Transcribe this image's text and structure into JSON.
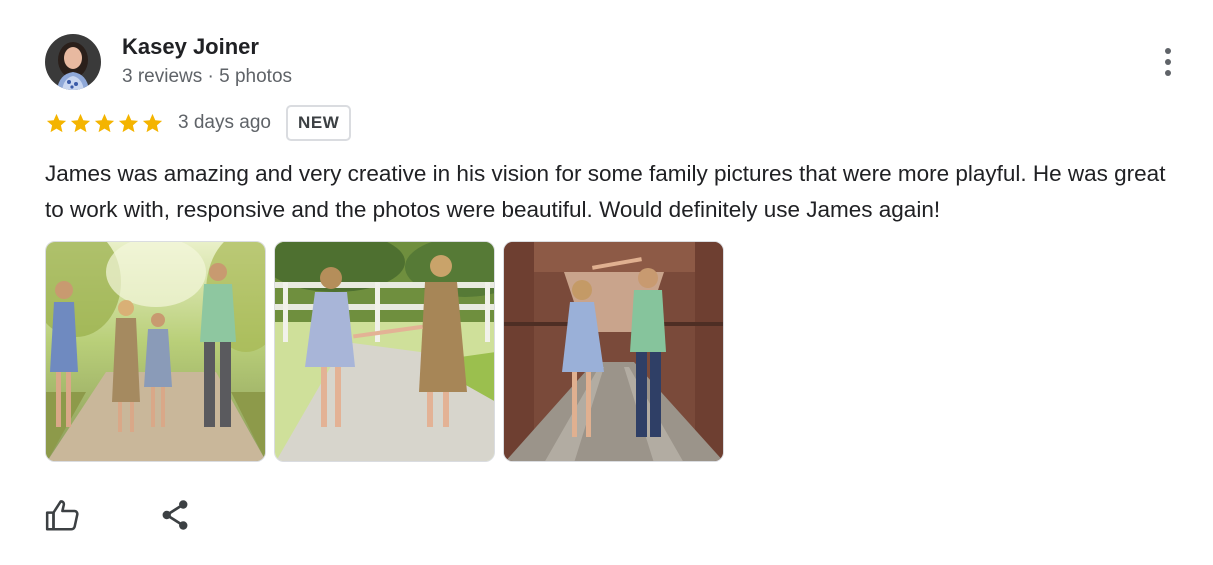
{
  "author": {
    "name": "Kasey Joiner",
    "meta": "3 reviews · 5 photos"
  },
  "review": {
    "rating": 5,
    "rating_max": 5,
    "date": "3 days ago",
    "badge": "NEW",
    "text": "James was amazing and very creative in his vision for some family pictures that were more playful. He was great to work with, responsive and the photos were beautiful. Would definitely use James again!",
    "photo_count": 3
  },
  "colors": {
    "star": "#f4b400",
    "text_primary": "#202124",
    "text_secondary": "#5f6368",
    "border": "#dadce0"
  },
  "icons": {
    "more": "more-vert-icon",
    "like": "thumb-up-icon",
    "share": "share-icon",
    "star": "star-icon"
  }
}
